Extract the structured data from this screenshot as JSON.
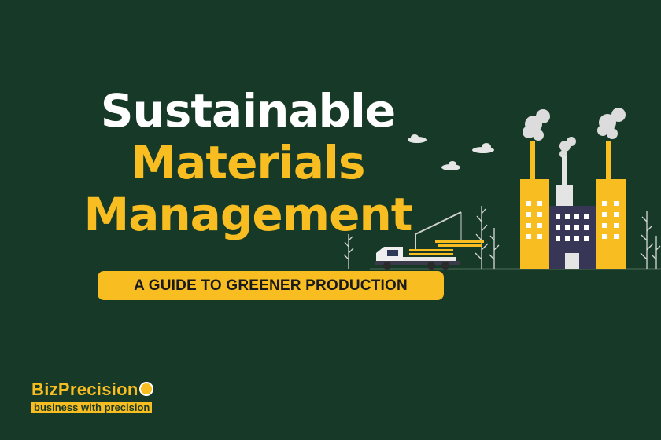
{
  "title": {
    "line1": "Sustainable",
    "line2": "Materials",
    "line3": "Management"
  },
  "subtitle": "A GUIDE TO GREENER PRODUCTION",
  "logo": {
    "name": "BizPrecision",
    "tagline": "business with precision"
  },
  "colors": {
    "background": "#173a28",
    "accent": "#f7bd21",
    "white": "#ffffff"
  },
  "icons": [
    "factory-icon",
    "truck-icon",
    "smoke-icon",
    "cloud-icon",
    "plant-icon"
  ]
}
